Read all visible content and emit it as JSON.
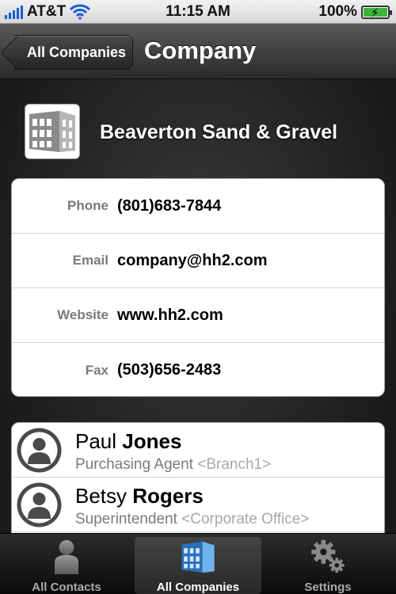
{
  "status_bar": {
    "carrier": "AT&T",
    "time": "11:15 AM",
    "battery": "100%",
    "battery_level": 1.0
  },
  "nav": {
    "back_label": "All Companies",
    "title": "Company"
  },
  "company": {
    "name": "Beaverton Sand & Gravel",
    "logo_icon": "building-icon"
  },
  "details": [
    {
      "label": "Phone",
      "value": "(801)683-7844"
    },
    {
      "label": "Email",
      "value": "company@hh2.com"
    },
    {
      "label": "Website",
      "value": "www.hh2.com"
    },
    {
      "label": "Fax",
      "value": "(503)656-2483"
    }
  ],
  "contacts": [
    {
      "first": "Paul",
      "last": "Jones",
      "title": "Purchasing Agent",
      "branch": "<Branch1>"
    },
    {
      "first": "Betsy",
      "last": "Rogers",
      "title": "Superintendent",
      "branch": "<Corporate Office>"
    }
  ],
  "tabs": [
    {
      "label": "All Contacts",
      "icon": "person-icon",
      "active": false
    },
    {
      "label": "All Companies",
      "icon": "building-icon",
      "active": true
    },
    {
      "label": "Settings",
      "icon": "gear-icon",
      "active": false
    }
  ],
  "colors": {
    "accent_blue": "#1a5dcf",
    "building_blue": "#3b8fd6"
  }
}
